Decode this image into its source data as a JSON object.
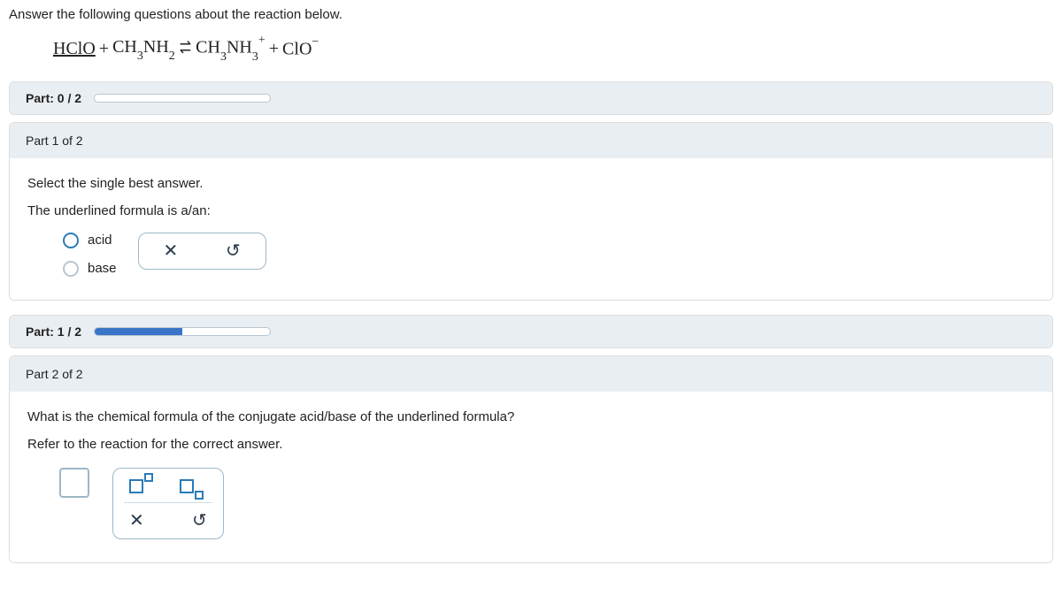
{
  "intro": "Answer the following questions about the reaction below.",
  "equation": {
    "reactant1": {
      "text": "HClO",
      "underlined": true
    },
    "plus1": "+",
    "reactant2": {
      "base": "CH",
      "sub1": "3",
      "mid": "NH",
      "sub2": "2"
    },
    "equilibrium": true,
    "product1": {
      "base": "CH",
      "sub1": "3",
      "mid": "NH",
      "sub2": "3",
      "sup": "+"
    },
    "plus2": "+",
    "product2": {
      "base": "ClO",
      "sup": "−"
    }
  },
  "progress": [
    {
      "label": "Part: 0 / 2",
      "percent": 0
    },
    {
      "label": "Part: 1 / 2",
      "percent": 50
    }
  ],
  "part1": {
    "header": "Part 1 of 2",
    "instr1": "Select the single best answer.",
    "instr2": "The underlined formula is a/an:",
    "options": [
      "acid",
      "base"
    ]
  },
  "part2": {
    "header": "Part 2 of 2",
    "instr1": "What is the chemical formula of the conjugate acid/base of the underlined formula?",
    "instr2": "Refer to the reaction for the correct answer."
  },
  "tools": {
    "clear": "✕",
    "undo": "↻",
    "superscript_name": "superscript-button",
    "subscript_name": "subscript-button"
  }
}
